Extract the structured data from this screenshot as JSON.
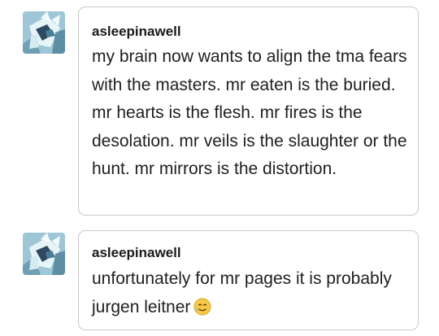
{
  "posts": [
    {
      "username": "asleepinawell",
      "avatar_icon": "character-avatar-icon",
      "message": "my brain now wants to align the tma fears with the masters. mr eaten is the buried. mr hearts is the flesh. mr fires is the desolation. mr veils is the slaughter or the hunt. mr mirrors is the distortion."
    },
    {
      "username": "asleepinawell",
      "avatar_icon": "character-avatar-icon",
      "message": "unfortunately for mr pages it is probably jurgen leitner",
      "emoji_icon": "smiling-face-with-tear-emoji-icon"
    }
  ],
  "colors": {
    "bubble_border": "#c8c8c8",
    "text": "#1f1f1f",
    "avatar_bg": "#8fb8c9"
  }
}
